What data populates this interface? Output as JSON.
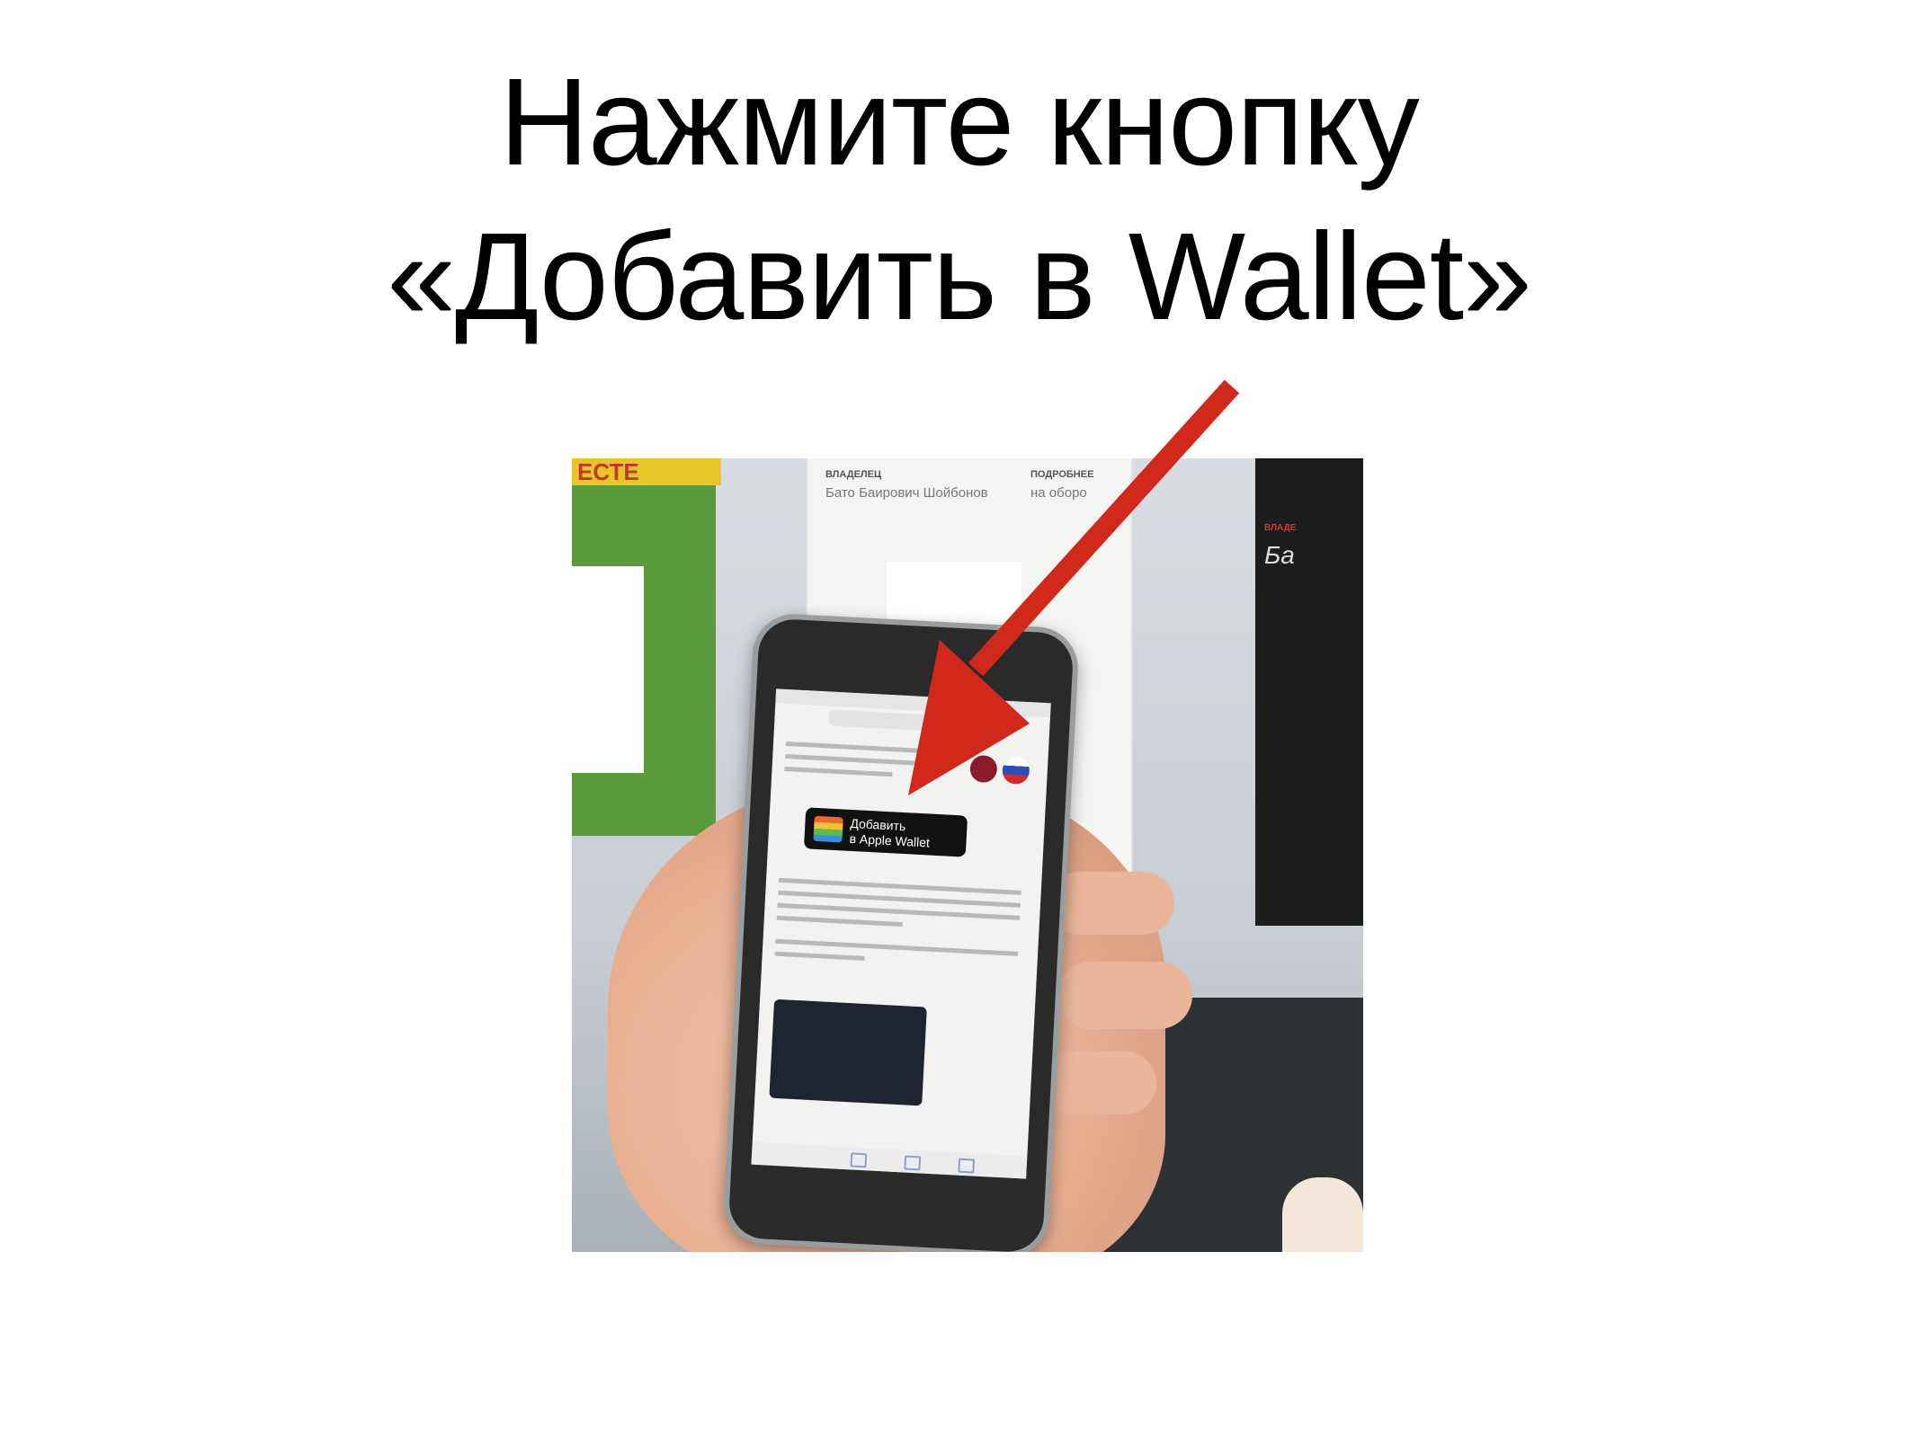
{
  "slide": {
    "title_line1": "Нажмите кнопку",
    "title_line2": "«Добавить в Wallet»"
  },
  "photo": {
    "wallet_button": {
      "line1": "Добавить",
      "line2": "в Apple Wallet"
    },
    "card_center": {
      "owner_label": "ВЛАДЕЛЕЦ",
      "owner_value": "Бато Баирович Шойбонов",
      "details_label": "ПОДРОБНЕЕ",
      "details_value": "на оборо"
    },
    "card_right": {
      "owner_label": "ВЛАДЕ",
      "owner_value": "Ба"
    },
    "screen_left_header": "ЕСТЕ"
  },
  "colors": {
    "arrow": "#d0281a",
    "title": "#000000",
    "background": "#ffffff"
  }
}
